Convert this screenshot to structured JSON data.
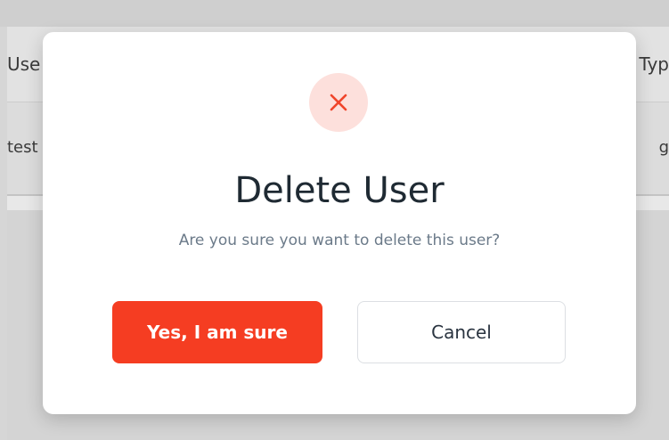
{
  "background": {
    "header_left_partial": "Use",
    "header_right_partial": "Typ",
    "row_left_partial": "test",
    "row_right_partial": "g"
  },
  "dialog": {
    "icon": "close-icon",
    "title": "Delete User",
    "message": "Are you sure you want to delete this user?",
    "confirm_label": "Yes, I am sure",
    "cancel_label": "Cancel"
  },
  "colors": {
    "confirm_button": "#f53d22",
    "icon_circle_bg": "#fde0dc",
    "icon_color": "#f0452b"
  }
}
